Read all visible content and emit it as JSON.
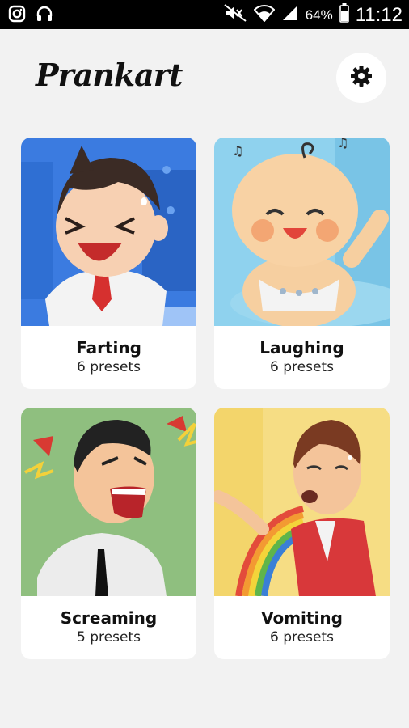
{
  "status_bar": {
    "battery_percent": "64%",
    "time": "11:12",
    "icons": [
      "instagram-icon",
      "headphones-icon",
      "mute-icon",
      "wifi-icon",
      "signal-icon",
      "battery-icon"
    ]
  },
  "app": {
    "title": "Prankart"
  },
  "cards": [
    {
      "title": "Farting",
      "subtitle": "6 presets",
      "accent": "#3b7be0"
    },
    {
      "title": "Laughing",
      "subtitle": "6 presets",
      "accent": "#79c4e6"
    },
    {
      "title": "Screaming",
      "subtitle": "5 presets",
      "accent": "#8fbf7f"
    },
    {
      "title": "Vomiting",
      "subtitle": "6 presets",
      "accent": "#f3d56b"
    }
  ]
}
